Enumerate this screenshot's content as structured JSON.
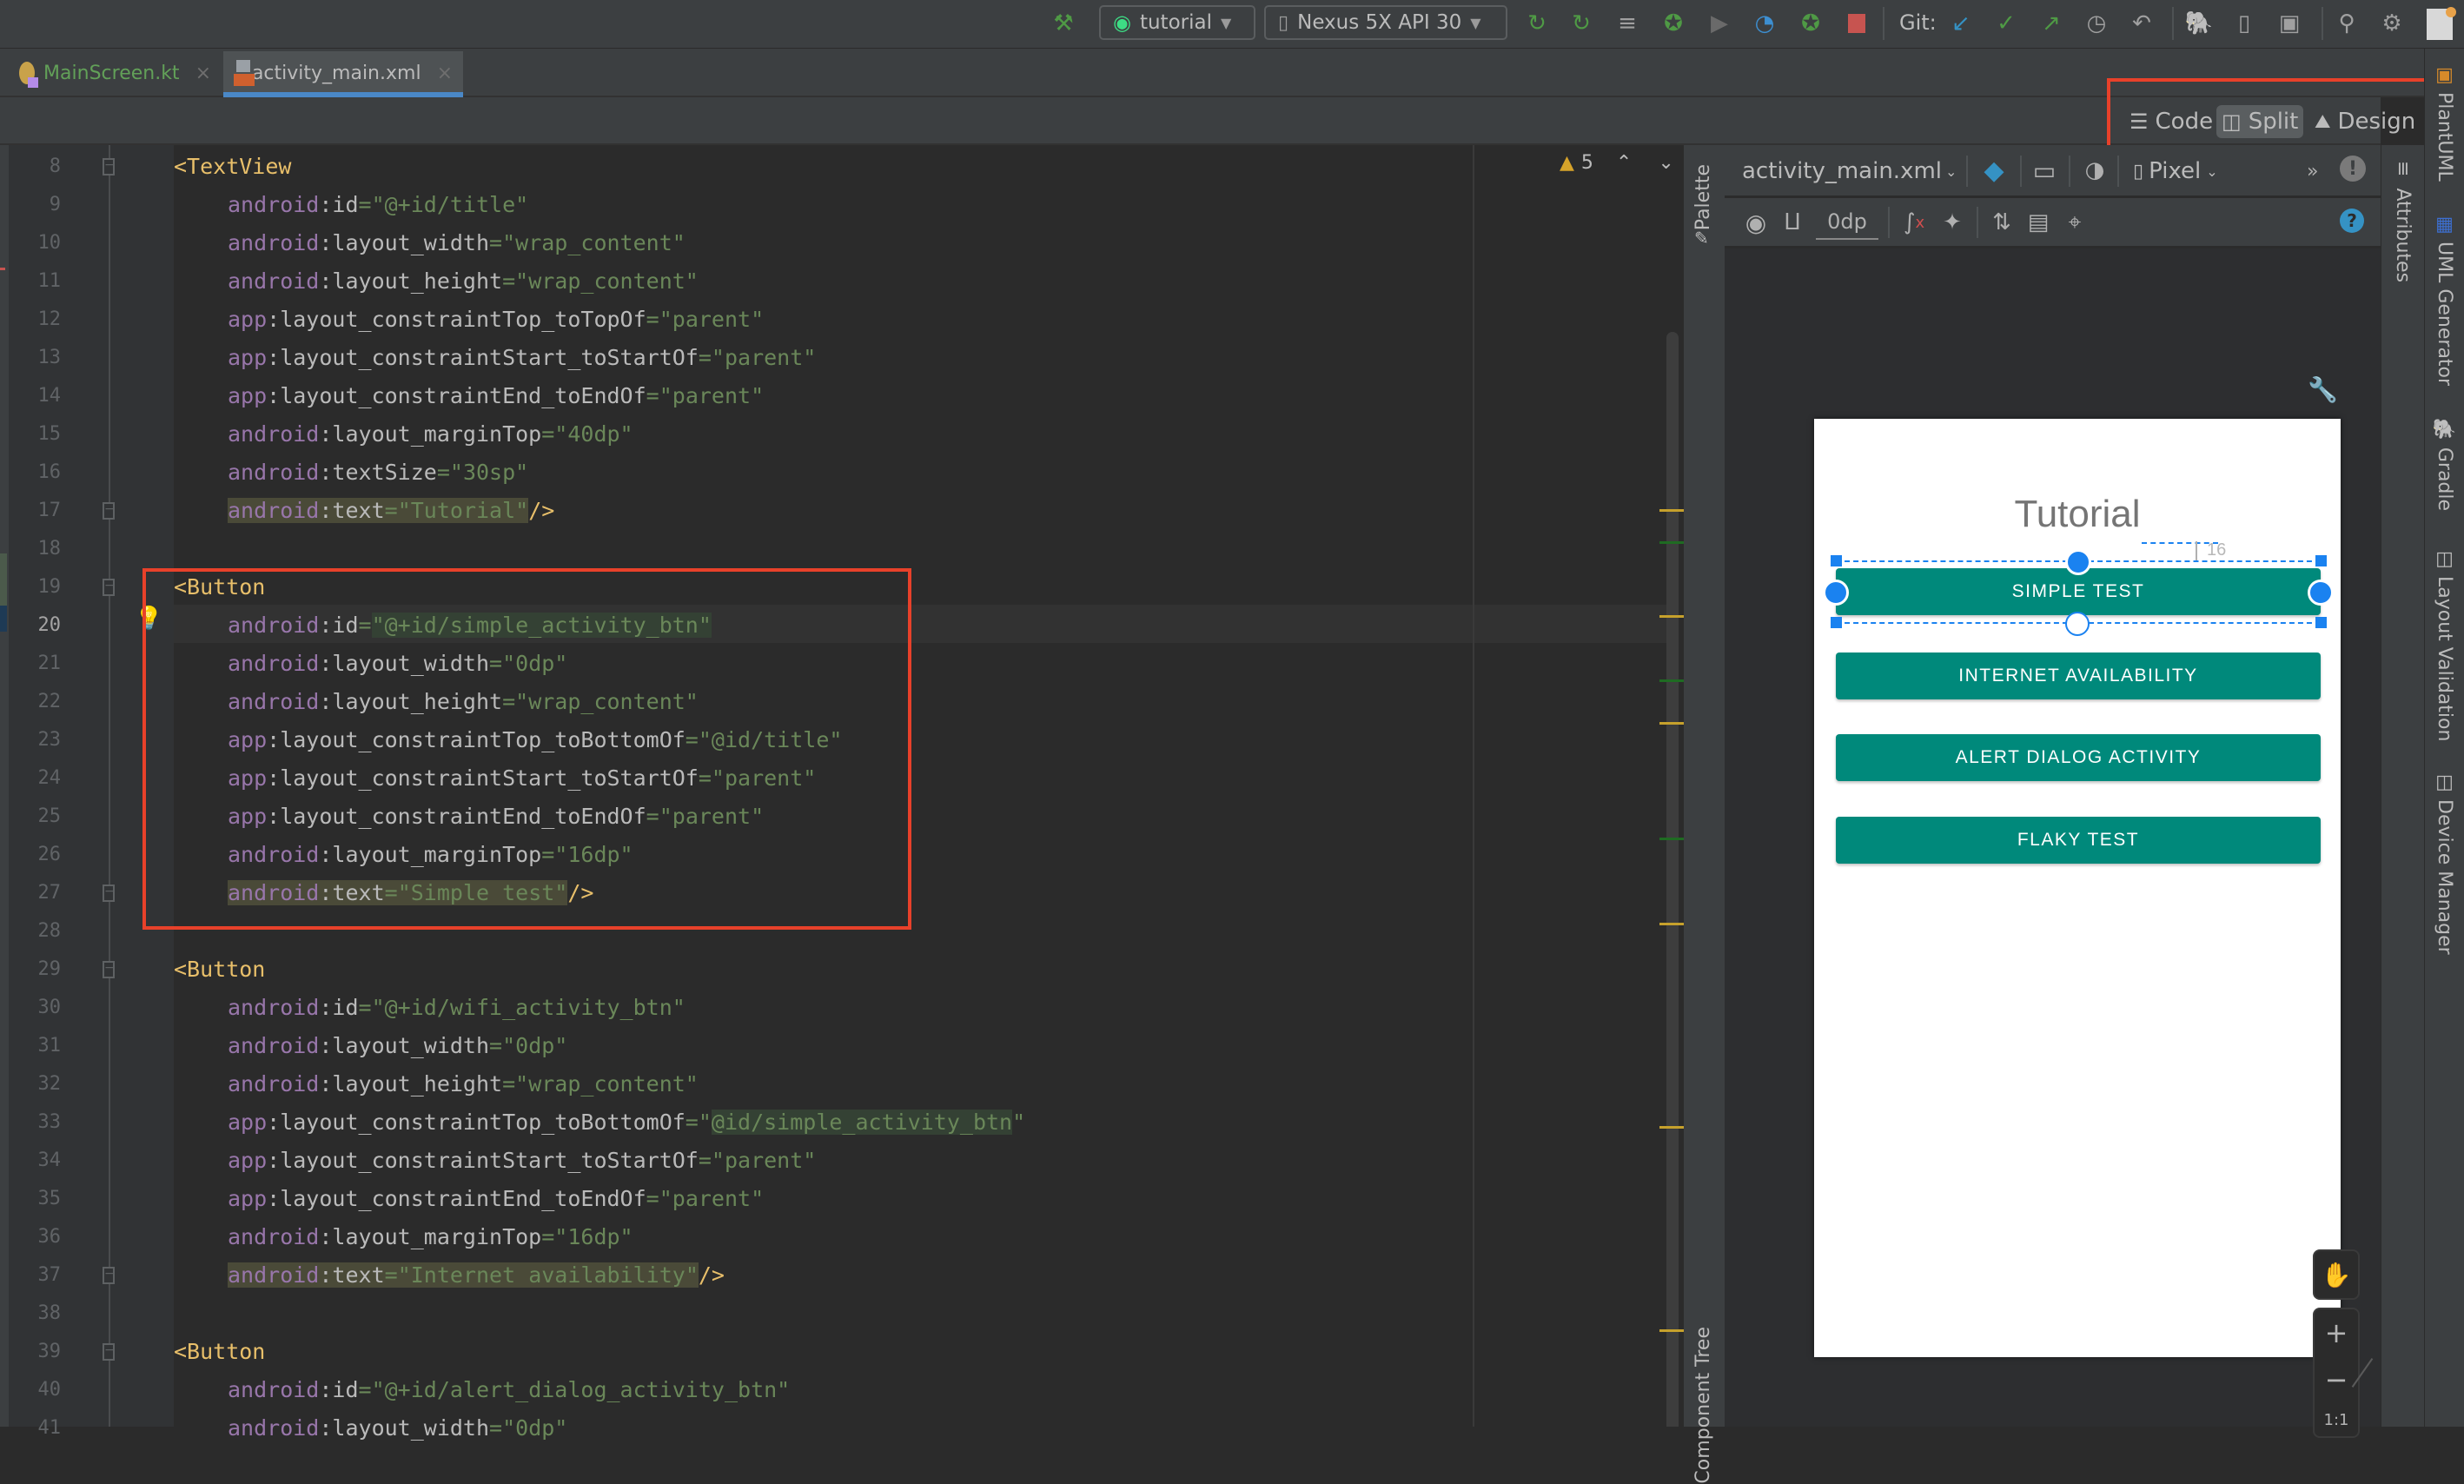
{
  "toolbar": {
    "build_icon": "hammer-icon",
    "run_config": "tutorial",
    "device": "Nexus 5X API 30",
    "git_label": "Git:",
    "icons": [
      "apply-changes-icon",
      "apply-code-changes-icon",
      "sync-project-icon",
      "debug-icon",
      "run-coverage-icon",
      "profile-icon",
      "attach-debugger-icon",
      "stop-icon",
      "git-update-icon",
      "git-commit-icon",
      "git-push-icon",
      "git-history-icon",
      "git-rollback-icon",
      "gradle-sync-icon",
      "device-manager-icon",
      "sdk-manager-icon",
      "search-icon",
      "settings-icon",
      "avatar"
    ]
  },
  "tabs": [
    {
      "label": "MainScreen.kt",
      "active": false
    },
    {
      "label": "activity_main.xml",
      "active": true
    }
  ],
  "view_modes": {
    "code": "Code",
    "split": "Split",
    "design": "Design",
    "selected": "Split"
  },
  "editor": {
    "current_line": 20,
    "inspection": {
      "warnings": "5"
    },
    "lines": [
      {
        "n": "8",
        "parts": [
          [
            "tag",
            "<TextView"
          ]
        ]
      },
      {
        "n": "9",
        "parts": [
          [
            "ns",
            "android"
          ],
          [
            "attr",
            ":id"
          ],
          [
            "eq",
            "="
          ],
          [
            "val",
            "\"@+id/title\""
          ]
        ]
      },
      {
        "n": "10",
        "parts": [
          [
            "ns",
            "android"
          ],
          [
            "attr",
            ":layout_width"
          ],
          [
            "eq",
            "="
          ],
          [
            "val",
            "\"wrap_content\""
          ]
        ]
      },
      {
        "n": "11",
        "parts": [
          [
            "ns",
            "android"
          ],
          [
            "attr",
            ":layout_height"
          ],
          [
            "eq",
            "="
          ],
          [
            "val",
            "\"wrap_content\""
          ]
        ]
      },
      {
        "n": "12",
        "parts": [
          [
            "ns",
            "app"
          ],
          [
            "attr",
            ":layout_constraintTop_toTopOf"
          ],
          [
            "eq",
            "="
          ],
          [
            "val",
            "\"parent\""
          ]
        ]
      },
      {
        "n": "13",
        "parts": [
          [
            "ns",
            "app"
          ],
          [
            "attr",
            ":layout_constraintStart_toStartOf"
          ],
          [
            "eq",
            "="
          ],
          [
            "val",
            "\"parent\""
          ]
        ]
      },
      {
        "n": "14",
        "parts": [
          [
            "ns",
            "app"
          ],
          [
            "attr",
            ":layout_constraintEnd_toEndOf"
          ],
          [
            "eq",
            "="
          ],
          [
            "val",
            "\"parent\""
          ]
        ]
      },
      {
        "n": "15",
        "parts": [
          [
            "ns",
            "android"
          ],
          [
            "attr",
            ":layout_marginTop"
          ],
          [
            "eq",
            "="
          ],
          [
            "val",
            "\"40dp\""
          ]
        ]
      },
      {
        "n": "16",
        "parts": [
          [
            "ns",
            "android"
          ],
          [
            "attr",
            ":textSize"
          ],
          [
            "eq",
            "="
          ],
          [
            "val",
            "\"30sp\""
          ]
        ]
      },
      {
        "n": "17",
        "parts": [
          [
            "ns hl",
            "android"
          ],
          [
            "attr hl",
            ":text"
          ],
          [
            "eq hl",
            "="
          ],
          [
            "val hl",
            "\"Tutorial\""
          ],
          [
            "tag",
            "/>"
          ]
        ]
      },
      {
        "n": "18",
        "parts": []
      },
      {
        "n": "19",
        "parts": [
          [
            "tag",
            "<Button"
          ]
        ]
      },
      {
        "n": "20",
        "parts": [
          [
            "ns",
            "android"
          ],
          [
            "attr",
            ":id"
          ],
          [
            "eq",
            "="
          ],
          [
            "val idh",
            "\"@+id/simple_activity_btn\""
          ]
        ]
      },
      {
        "n": "21",
        "parts": [
          [
            "ns",
            "android"
          ],
          [
            "attr",
            ":layout_width"
          ],
          [
            "eq",
            "="
          ],
          [
            "val",
            "\"0dp\""
          ]
        ]
      },
      {
        "n": "22",
        "parts": [
          [
            "ns",
            "android"
          ],
          [
            "attr",
            ":layout_height"
          ],
          [
            "eq",
            "="
          ],
          [
            "val",
            "\"wrap_content\""
          ]
        ]
      },
      {
        "n": "23",
        "parts": [
          [
            "ns",
            "app"
          ],
          [
            "attr",
            ":layout_constraintTop_toBottomOf"
          ],
          [
            "eq",
            "="
          ],
          [
            "val",
            "\"@id/title\""
          ]
        ]
      },
      {
        "n": "24",
        "parts": [
          [
            "ns",
            "app"
          ],
          [
            "attr",
            ":layout_constraintStart_toStartOf"
          ],
          [
            "eq",
            "="
          ],
          [
            "val",
            "\"parent\""
          ]
        ]
      },
      {
        "n": "25",
        "parts": [
          [
            "ns",
            "app"
          ],
          [
            "attr",
            ":layout_constraintEnd_toEndOf"
          ],
          [
            "eq",
            "="
          ],
          [
            "val",
            "\"parent\""
          ]
        ]
      },
      {
        "n": "26",
        "parts": [
          [
            "ns",
            "android"
          ],
          [
            "attr",
            ":layout_marginTop"
          ],
          [
            "eq",
            "="
          ],
          [
            "val",
            "\"16dp\""
          ]
        ]
      },
      {
        "n": "27",
        "parts": [
          [
            "ns hl",
            "android"
          ],
          [
            "attr hl",
            ":text"
          ],
          [
            "eq hl",
            "="
          ],
          [
            "val hl",
            "\"Simple test\""
          ],
          [
            "tag",
            "/>"
          ]
        ]
      },
      {
        "n": "28",
        "parts": []
      },
      {
        "n": "29",
        "parts": [
          [
            "tag",
            "<Button"
          ]
        ]
      },
      {
        "n": "30",
        "parts": [
          [
            "ns",
            "android"
          ],
          [
            "attr",
            ":id"
          ],
          [
            "eq",
            "="
          ],
          [
            "val",
            "\"@+id/wifi_activity_btn\""
          ]
        ]
      },
      {
        "n": "31",
        "parts": [
          [
            "ns",
            "android"
          ],
          [
            "attr",
            ":layout_width"
          ],
          [
            "eq",
            "="
          ],
          [
            "val",
            "\"0dp\""
          ]
        ]
      },
      {
        "n": "32",
        "parts": [
          [
            "ns",
            "android"
          ],
          [
            "attr",
            ":layout_height"
          ],
          [
            "eq",
            "="
          ],
          [
            "val",
            "\"wrap_content\""
          ]
        ]
      },
      {
        "n": "33",
        "parts": [
          [
            "ns",
            "app"
          ],
          [
            "attr",
            ":layout_constraintTop_toBottomOf"
          ],
          [
            "eq",
            "="
          ],
          [
            "val",
            "\""
          ],
          [
            "val idh",
            "@id/simple_activity_btn"
          ],
          [
            "val",
            "\""
          ]
        ]
      },
      {
        "n": "34",
        "parts": [
          [
            "ns",
            "app"
          ],
          [
            "attr",
            ":layout_constraintStart_toStartOf"
          ],
          [
            "eq",
            "="
          ],
          [
            "val",
            "\"parent\""
          ]
        ]
      },
      {
        "n": "35",
        "parts": [
          [
            "ns",
            "app"
          ],
          [
            "attr",
            ":layout_constraintEnd_toEndOf"
          ],
          [
            "eq",
            "="
          ],
          [
            "val",
            "\"parent\""
          ]
        ]
      },
      {
        "n": "36",
        "parts": [
          [
            "ns",
            "android"
          ],
          [
            "attr",
            ":layout_marginTop"
          ],
          [
            "eq",
            "="
          ],
          [
            "val",
            "\"16dp\""
          ]
        ]
      },
      {
        "n": "37",
        "parts": [
          [
            "ns hl",
            "android"
          ],
          [
            "attr hl",
            ":text"
          ],
          [
            "eq hl",
            "="
          ],
          [
            "val hl",
            "\"Internet availability\""
          ],
          [
            "tag",
            "/>"
          ]
        ]
      },
      {
        "n": "38",
        "parts": []
      },
      {
        "n": "39",
        "parts": [
          [
            "tag",
            "<Button"
          ]
        ]
      },
      {
        "n": "40",
        "parts": [
          [
            "ns",
            "android"
          ],
          [
            "attr",
            ":id"
          ],
          [
            "eq",
            "="
          ],
          [
            "val",
            "\"@+id/alert_dialog_activity_btn\""
          ]
        ]
      },
      {
        "n": "41",
        "parts": [
          [
            "ns",
            "android"
          ],
          [
            "attr",
            ":layout_width"
          ],
          [
            "eq",
            "="
          ],
          [
            "val",
            "\"0dp\""
          ]
        ]
      }
    ]
  },
  "side_panels": {
    "palette": "Palette",
    "component_tree": "Component Tree",
    "attributes": "Attributes",
    "right_tools": [
      "PlantUML",
      "UML Generator",
      "Gradle",
      "Layout Validation",
      "Device Manager"
    ]
  },
  "design": {
    "file_selector": "activity_main.xml",
    "device_selector": "Pixel",
    "default_margin": "0dp",
    "margin_indicator": "16",
    "preview": {
      "title": "Tutorial",
      "buttons": [
        "SIMPLE TEST",
        "INTERNET AVAILABILITY",
        "ALERT DIALOG ACTIVITY",
        "FLAKY TEST"
      ],
      "selected_button": "SIMPLE TEST",
      "button_color": "#00897b"
    },
    "zoom_controls": {
      "zoom_in": "+",
      "zoom_out": "−",
      "reset": "1:1"
    }
  },
  "colors": {
    "accent_blue": "#4a88c7",
    "annotation_red": "#e8412a",
    "selection_blue": "#1a82f0"
  }
}
